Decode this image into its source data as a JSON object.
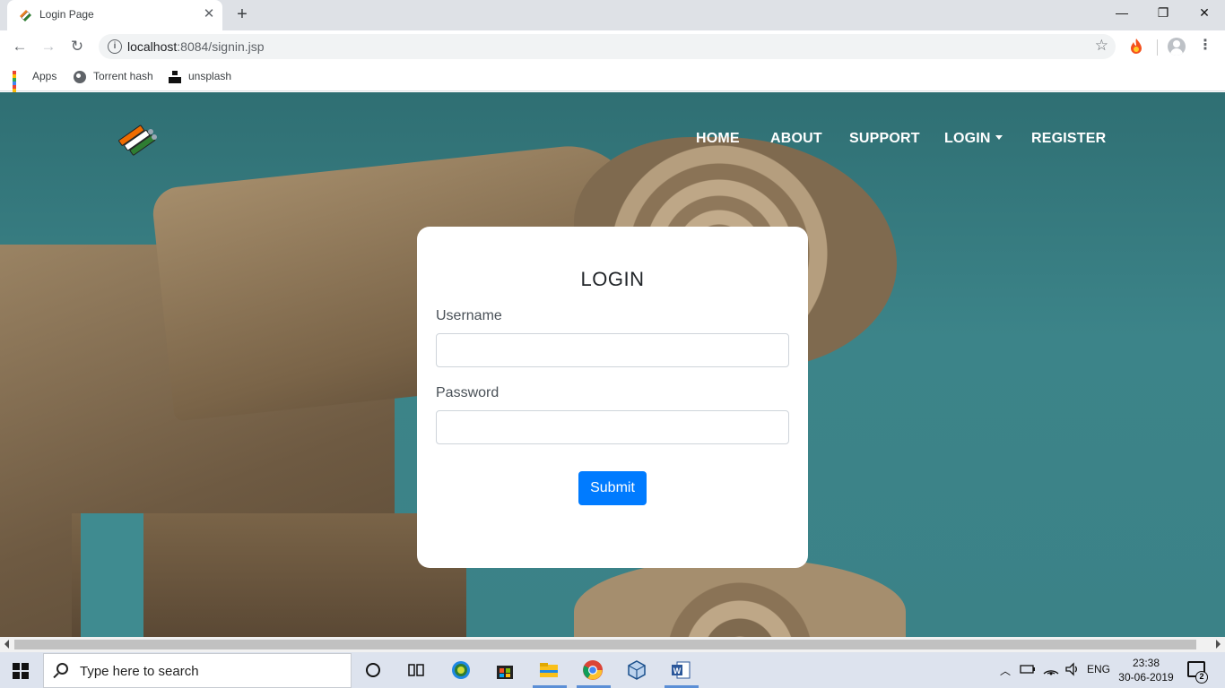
{
  "browser": {
    "tab_title": "Login Page",
    "close_tab": "✕",
    "new_tab": "+",
    "window_controls": {
      "minimize": "—",
      "maximize": "❐",
      "close": "✕"
    },
    "url_host": "localhost",
    "url_path": ":8084/signin.jsp",
    "bookmarks": [
      {
        "label": "Apps",
        "icon": "apps-grid-icon"
      },
      {
        "label": "Torrent hash",
        "icon": "globe-icon"
      },
      {
        "label": "unsplash",
        "icon": "unsplash-icon"
      }
    ]
  },
  "site": {
    "nav": {
      "home": "HOME",
      "about": "ABOUT",
      "support": "SUPPORT",
      "login": "LOGIN",
      "register": "REGISTER"
    },
    "form": {
      "title": "LOGIN",
      "username_label": "Username",
      "username_value": "",
      "password_label": "Password",
      "password_value": "",
      "submit_label": "Submit"
    },
    "colors": {
      "primary": "#007bff",
      "card": "#ffffff",
      "sky": "#3c8489"
    }
  },
  "taskbar": {
    "search_placeholder": "Type here to search",
    "language": "ENG",
    "time": "23:38",
    "date": "30-06-2019",
    "notifications": "2",
    "apps": [
      "cortana-icon",
      "task-view-icon",
      "edge-dev-icon",
      "store-icon",
      "file-explorer-icon",
      "chrome-icon",
      "virtualbox-icon",
      "word-icon"
    ]
  }
}
